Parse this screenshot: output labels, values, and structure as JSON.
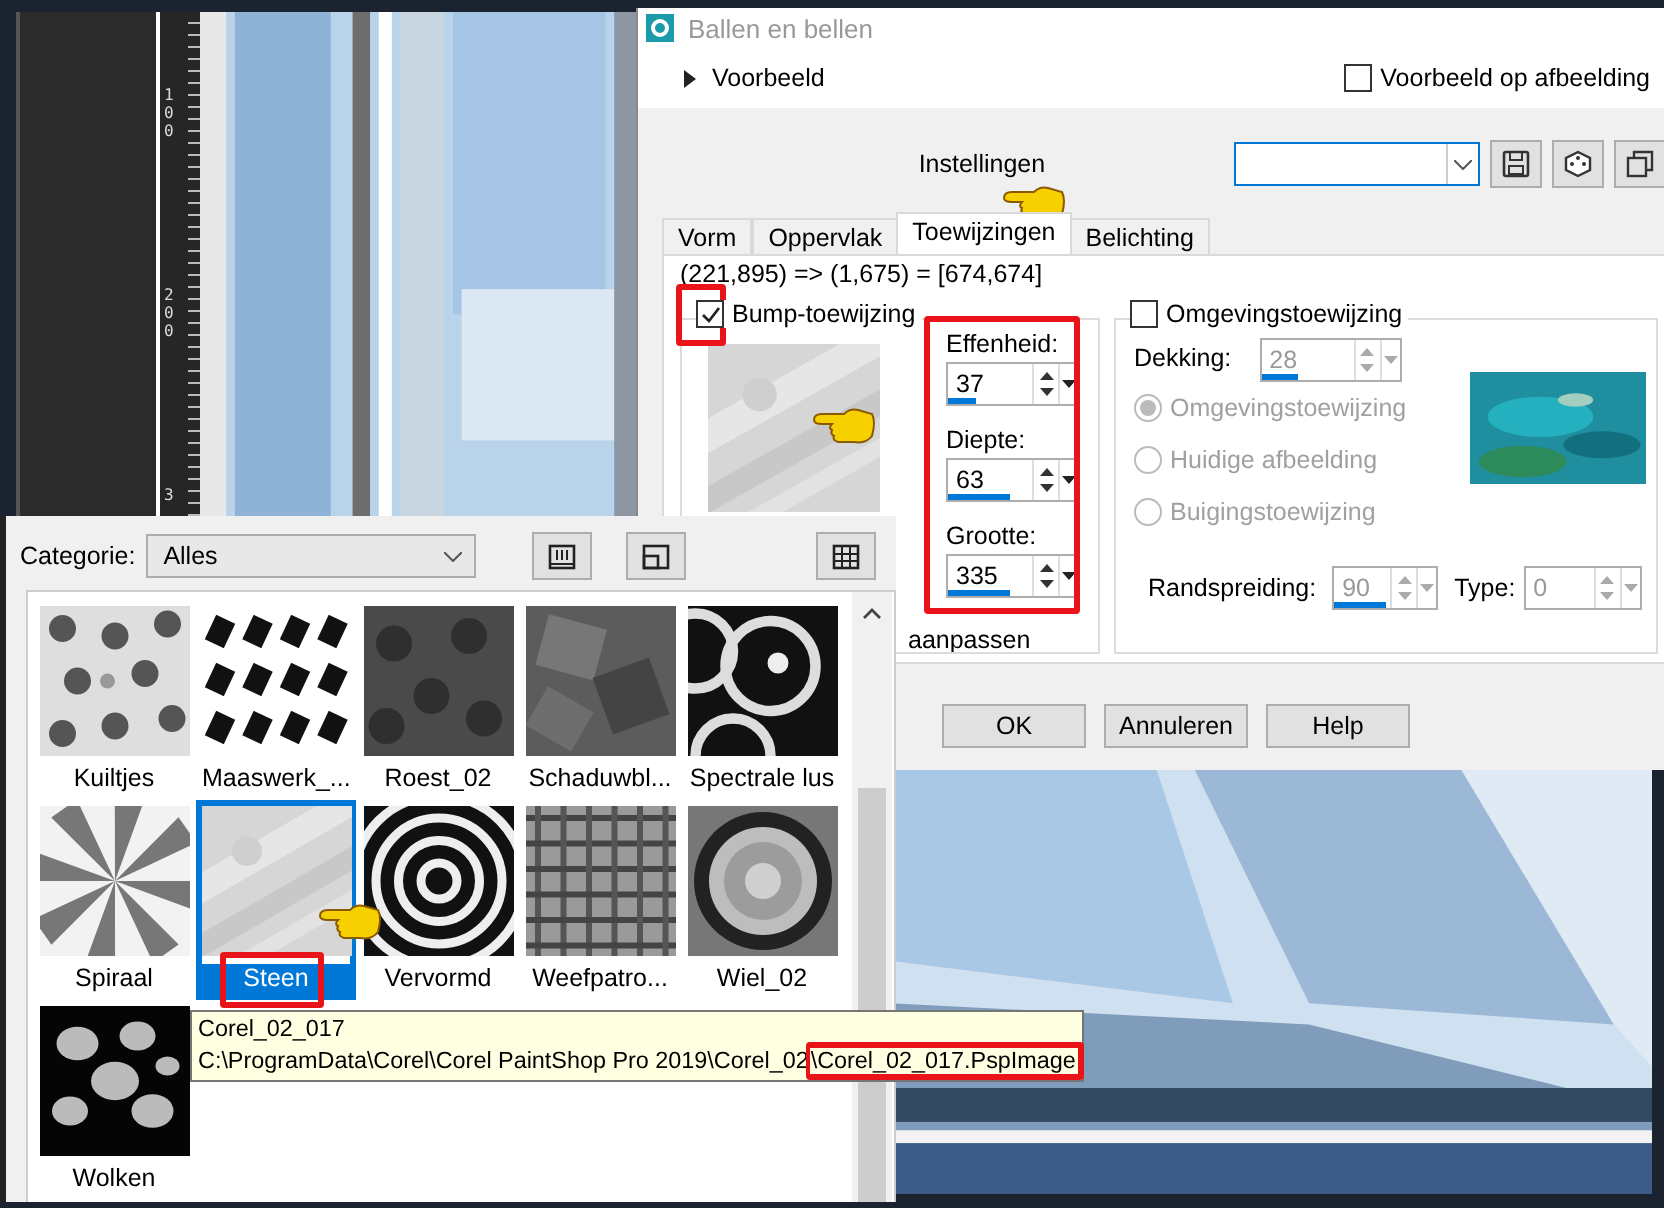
{
  "canvas": {
    "ruler_labels": [
      "100",
      "200",
      "3"
    ]
  },
  "dialog": {
    "title": "Ballen en bellen",
    "preview": {
      "label": "Voorbeeld",
      "expanded": false
    },
    "preview_on_image": {
      "label": "Voorbeeld op afbeelding",
      "checked": false
    },
    "settings_label": "Instellingen",
    "tabs": [
      {
        "label": "Vorm",
        "selected": false
      },
      {
        "label": "Oppervlak",
        "selected": false
      },
      {
        "label": "Toewijzingen",
        "selected": true
      },
      {
        "label": "Belichting",
        "selected": false
      }
    ],
    "coordinates": "(221,895) => (1,675) = [674,674]",
    "bump_map": {
      "label": "Bump-toewijzing",
      "checked": true,
      "fields": [
        {
          "label": "Effenheid:",
          "value": "37",
          "level": 0.33
        },
        {
          "label": "Diepte:",
          "value": "63",
          "level": 0.73
        },
        {
          "label": "Grootte:",
          "value": "335",
          "level": 0.73
        }
      ],
      "adjust_label": "aanpassen"
    },
    "environment_map": {
      "label": "Omgevingstoewijzing",
      "checked": false,
      "opacity": {
        "label": "Dekking:",
        "value": "28",
        "level": 0.4
      },
      "sources": [
        {
          "label": "Omgevingstoewijzing",
          "selected": true
        },
        {
          "label": "Huidige afbeelding",
          "selected": false
        },
        {
          "label": "Buigingstoewijzing",
          "selected": false
        }
      ],
      "spread": {
        "label": "Randspreiding:",
        "value": "90",
        "level": 0.93
      },
      "type": {
        "label": "Type:",
        "value": "0"
      }
    },
    "buttons": [
      "OK",
      "Annuleren",
      "Help"
    ]
  },
  "texture_picker": {
    "category_label": "Categorie:",
    "category": "Alles",
    "items": [
      {
        "label": "Kuiltjes",
        "selected": false
      },
      {
        "label": "Maaswerk_...",
        "selected": false
      },
      {
        "label": "Roest_02",
        "selected": false
      },
      {
        "label": "Schaduwbl...",
        "selected": false
      },
      {
        "label": "Spectrale lus",
        "selected": false
      },
      {
        "label": "Spiraal",
        "selected": false
      },
      {
        "label": "Steen",
        "selected": true
      },
      {
        "label": "Vervormd",
        "selected": false
      },
      {
        "label": "Weefpatro...",
        "selected": false
      },
      {
        "label": "Wiel_02",
        "selected": false
      },
      {
        "label": "Wolken",
        "selected": false
      }
    ]
  },
  "tooltip": {
    "name": "Corel_02_017",
    "path": "C:\\ProgramData\\Corel\\Corel PaintShop Pro 2019\\Corel_02\\Corel_02_017.PspImage"
  }
}
